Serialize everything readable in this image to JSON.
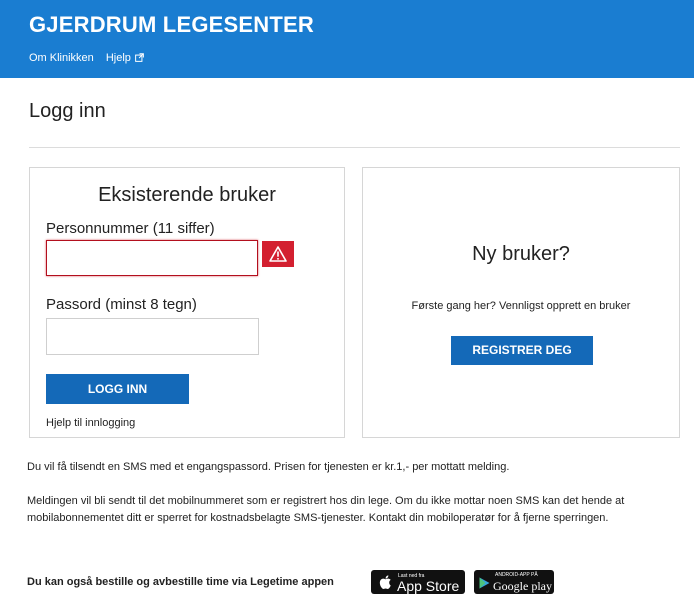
{
  "header": {
    "brand": "GJERDRUM LEGESENTER",
    "nav": {
      "about": "Om Klinikken",
      "help": "Hjelp"
    },
    "bg_color": "#1a7dd1"
  },
  "page": {
    "title": "Logg inn"
  },
  "existing_user": {
    "title": "Eksisterende bruker",
    "personnummer_label": "Personnummer (11 siffer)",
    "personnummer_value": "",
    "password_label": "Passord (minst 8 tegn)",
    "password_value": "",
    "login_button": "LOGG INN",
    "help_link": "Hjelp til innlogging",
    "error_icon": "warning-icon",
    "error_color": "#d32030"
  },
  "new_user": {
    "title": "Ny bruker?",
    "text": "Første gang her? Vennligst opprett en bruker",
    "register_button": "REGISTRER DEG",
    "button_color": "#1469b8"
  },
  "info": {
    "para1": "Du vil få tilsendt en SMS med et engangspassord. Prisen for tjenesten er kr.1,- per mottatt melding.",
    "para2": "Meldingen vil bli sendt til det mobilnummeret som er registrert hos din lege. Om du ikke mottar noen SMS kan det hende at mobilabonnementet ditt er sperret for kostnadsbelagte SMS-tjenester. Kontakt din mobiloperatør for å fjerne sperringen."
  },
  "apps": {
    "text": "Du kan også bestille og avbestille time via Legetime appen",
    "appstore_small": "Last ned fra",
    "appstore_big": "App Store",
    "googleplay_small": "ANDROID-APP PÅ",
    "googleplay_big": "Google play"
  }
}
